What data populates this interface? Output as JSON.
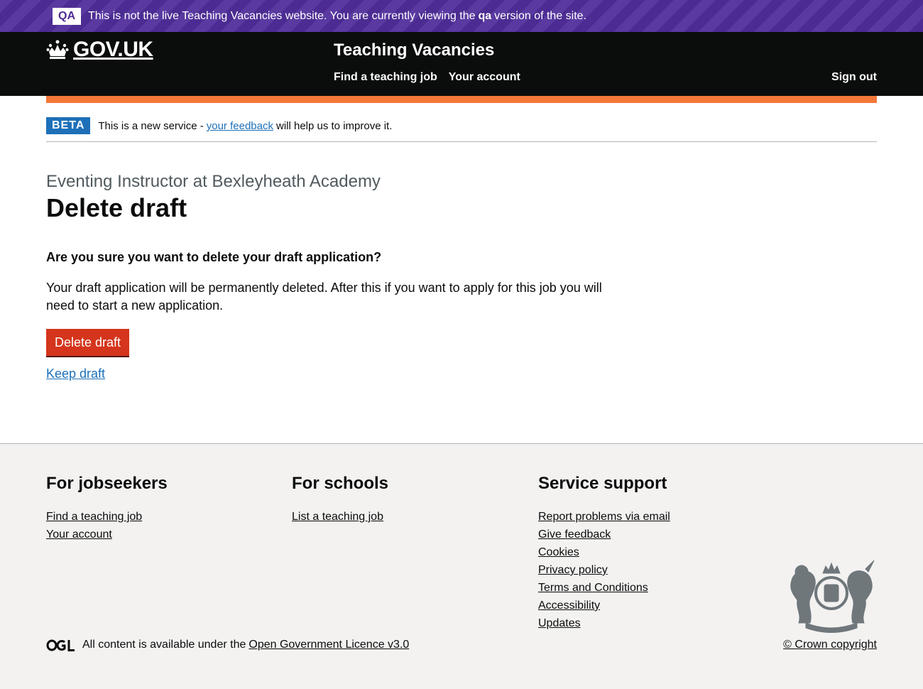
{
  "qa_banner": {
    "tag": "QA",
    "text_before": "This is not the live Teaching Vacancies website. You are currently viewing the",
    "env": "qa",
    "text_after": "version of the site."
  },
  "header": {
    "logo_text": "GOV.UK",
    "service_name": "Teaching Vacancies",
    "nav": [
      "Find a teaching job",
      "Your account"
    ],
    "sign_out": "Sign out"
  },
  "beta": {
    "tag": "BETA",
    "text_before": "This is a new service -",
    "link": "your feedback",
    "text_after": "will help us to improve it."
  },
  "main": {
    "caption": "Eventing Instructor at Bexleyheath Academy",
    "title": "Delete draft",
    "question": "Are you sure you want to delete your draft application?",
    "body": "Your draft application will be permanently deleted. After this if you want to apply for this job you will need to start a new application.",
    "delete_button": "Delete draft",
    "keep_link": "Keep draft"
  },
  "footer": {
    "jobseekers": {
      "heading": "For jobseekers",
      "links": [
        "Find a teaching job",
        "Your account"
      ]
    },
    "schools": {
      "heading": "For schools",
      "links": [
        "List a teaching job"
      ]
    },
    "support": {
      "heading": "Service support",
      "links": [
        "Report problems via email",
        "Give feedback",
        "Cookies",
        "Privacy policy",
        "Terms and Conditions",
        "Accessibility",
        "Updates"
      ]
    },
    "licence_text": "All content is available under the",
    "licence_link": "Open Government Licence v3.0",
    "copyright": "© Crown copyright"
  },
  "colors": {
    "qa_purple": "#4c2c92",
    "header_black": "#0b0c0c",
    "orange": "#f47738",
    "link_blue": "#1d70b8",
    "warning_red": "#d4351c",
    "footer_grey": "#f3f2f1"
  }
}
